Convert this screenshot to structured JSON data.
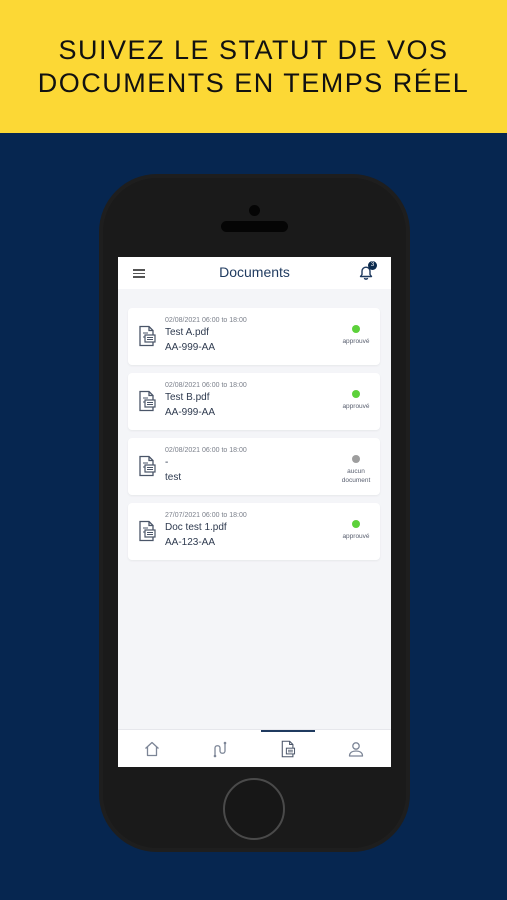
{
  "banner": {
    "line1": "SUIVEZ LE STATUT DE VOS",
    "line2": "DOCUMENTS EN TEMPS RÉEL"
  },
  "colors": {
    "banner_bg": "#FCD835",
    "page_bg": "#062650",
    "status_approved": "#5CD13A",
    "status_none": "#9E9E9E",
    "brand_navy": "#1F3A5F"
  },
  "topbar": {
    "menu_icon": "hamburger-menu-icon",
    "title": "Documents",
    "notification_icon": "bell-icon",
    "notification_count": "3"
  },
  "documents": [
    {
      "date": "02/08/2021 06:00 to 18:00",
      "name": "Test A.pdf",
      "plate": "AA-999-AA",
      "status": "approuvé",
      "status_color": "#5CD13A"
    },
    {
      "date": "02/08/2021 06:00 to 18:00",
      "name": "Test B.pdf",
      "plate": "AA-999-AA",
      "status": "approuvé",
      "status_color": "#5CD13A"
    },
    {
      "date": "02/08/2021 06:00 to 18:00",
      "name": "-",
      "plate": "test",
      "status": "aucun document",
      "status_color": "#9E9E9E"
    },
    {
      "date": "27/07/2021 06:00 to 18:00",
      "name": "Doc test 1.pdf",
      "plate": "AA-123-AA",
      "status": "approuvé",
      "status_color": "#5CD13A"
    }
  ],
  "bottom_nav": {
    "items": [
      "home-icon",
      "route-icon",
      "documents-icon",
      "profile-icon"
    ],
    "active": "documents-icon"
  }
}
